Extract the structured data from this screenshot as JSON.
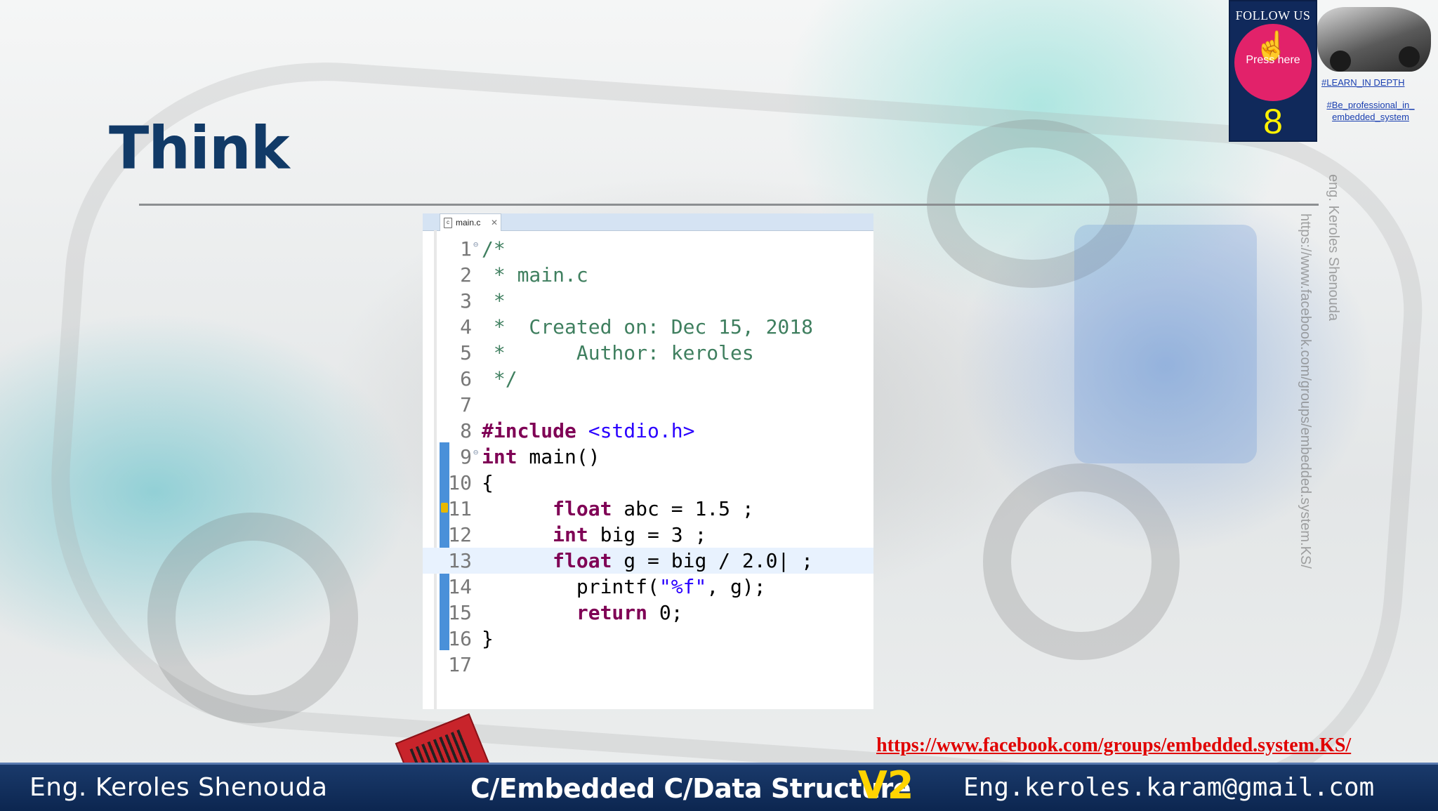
{
  "slide": {
    "title": "Think"
  },
  "follow_badge": {
    "label": "FOLLOW US",
    "press_text": "Press here",
    "number": "8",
    "tag_learn": "#LEARN_IN DEPTH",
    "tag_professional": "#Be_professional_in_ embedded_system"
  },
  "watermark": {
    "author_vertical": "eng. Keroles Shenouda",
    "url_vertical": "https://www.facebook.com/groups/embedded.system.KS/"
  },
  "editor": {
    "tab_label": "main.c",
    "tab_close": "✕",
    "lines": [
      {
        "num": "1",
        "fold": "⊖",
        "parts": [
          {
            "t": "/*",
            "c": "cmt"
          }
        ]
      },
      {
        "num": "2",
        "parts": [
          {
            "t": " * main.c",
            "c": "cmt"
          }
        ]
      },
      {
        "num": "3",
        "parts": [
          {
            "t": " *",
            "c": "cmt"
          }
        ]
      },
      {
        "num": "4",
        "parts": [
          {
            "t": " *  Created on: Dec 15, 2018",
            "c": "cmt"
          }
        ]
      },
      {
        "num": "5",
        "parts": [
          {
            "t": " *      Author: keroles",
            "c": "cmt"
          }
        ]
      },
      {
        "num": "6",
        "parts": [
          {
            "t": " */",
            "c": "cmt"
          }
        ]
      },
      {
        "num": "7",
        "parts": []
      },
      {
        "num": "8",
        "parts": [
          {
            "t": "#include",
            "c": "kw"
          },
          {
            "t": " "
          },
          {
            "t": "<stdio.h>",
            "c": "str"
          }
        ]
      },
      {
        "num": "9",
        "fold": "⊖",
        "parts": [
          {
            "t": "int",
            "c": "kw"
          },
          {
            "t": " main()"
          }
        ]
      },
      {
        "num": "10",
        "parts": [
          {
            "t": "{"
          }
        ]
      },
      {
        "num": "11",
        "warn": true,
        "parts": [
          {
            "t": "      "
          },
          {
            "t": "float",
            "c": "kw"
          },
          {
            "t": " abc = 1.5 ;"
          }
        ]
      },
      {
        "num": "12",
        "parts": [
          {
            "t": "      "
          },
          {
            "t": "int",
            "c": "kw"
          },
          {
            "t": " big = 3 ;"
          }
        ]
      },
      {
        "num": "13",
        "active": true,
        "parts": [
          {
            "t": "      "
          },
          {
            "t": "float",
            "c": "kw"
          },
          {
            "t": " g = big / 2.0| ;"
          }
        ]
      },
      {
        "num": "14",
        "parts": [
          {
            "t": "        printf("
          },
          {
            "t": "\"%f\"",
            "c": "str"
          },
          {
            "t": ", g);"
          }
        ]
      },
      {
        "num": "15",
        "parts": [
          {
            "t": "        "
          },
          {
            "t": "return",
            "c": "kw"
          },
          {
            "t": " 0;"
          }
        ]
      },
      {
        "num": "16",
        "parts": [
          {
            "t": "}"
          }
        ]
      },
      {
        "num": "17",
        "parts": []
      }
    ]
  },
  "footer": {
    "facebook_link": "https://www.facebook.com/groups/embedded.system.KS/",
    "left_name": "Eng. Keroles Shenouda",
    "center_title": "C/Embedded C/Data Structure",
    "version": "V2",
    "email": "Eng.keroles.karam@gmail.com"
  },
  "colors": {
    "title": "#113a67",
    "footer_bg": "#0c2650",
    "link_red": "#e00000",
    "version_yellow": "#ffd400",
    "keyword": "#7f0055",
    "comment": "#3f7f5f",
    "string": "#2a00ff"
  }
}
